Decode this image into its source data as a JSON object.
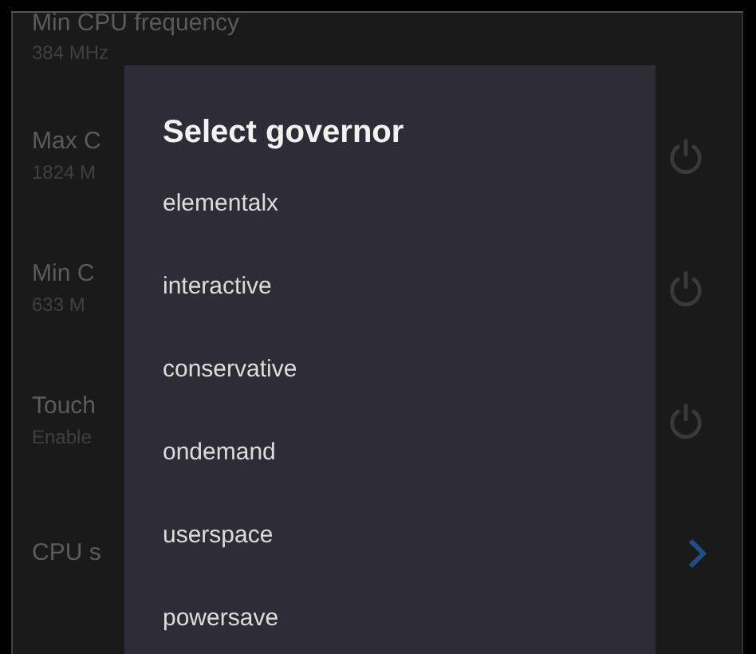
{
  "settings": [
    {
      "kind": "header",
      "title": "Min CPU frequency",
      "value": "384 MHz"
    },
    {
      "kind": "toggle",
      "title": "Max C",
      "value": "1824 M",
      "on": false
    },
    {
      "kind": "toggle",
      "title": "Min C",
      "value": "633 M",
      "on": false
    },
    {
      "kind": "toggle",
      "title": "Touch",
      "value": "Enable",
      "on": false
    },
    {
      "kind": "link",
      "title": "CPU s"
    }
  ],
  "dialog": {
    "title": "Select governor",
    "options": [
      "elementalx",
      "interactive",
      "conservative",
      "ondemand",
      "userspace",
      "powersave"
    ]
  }
}
